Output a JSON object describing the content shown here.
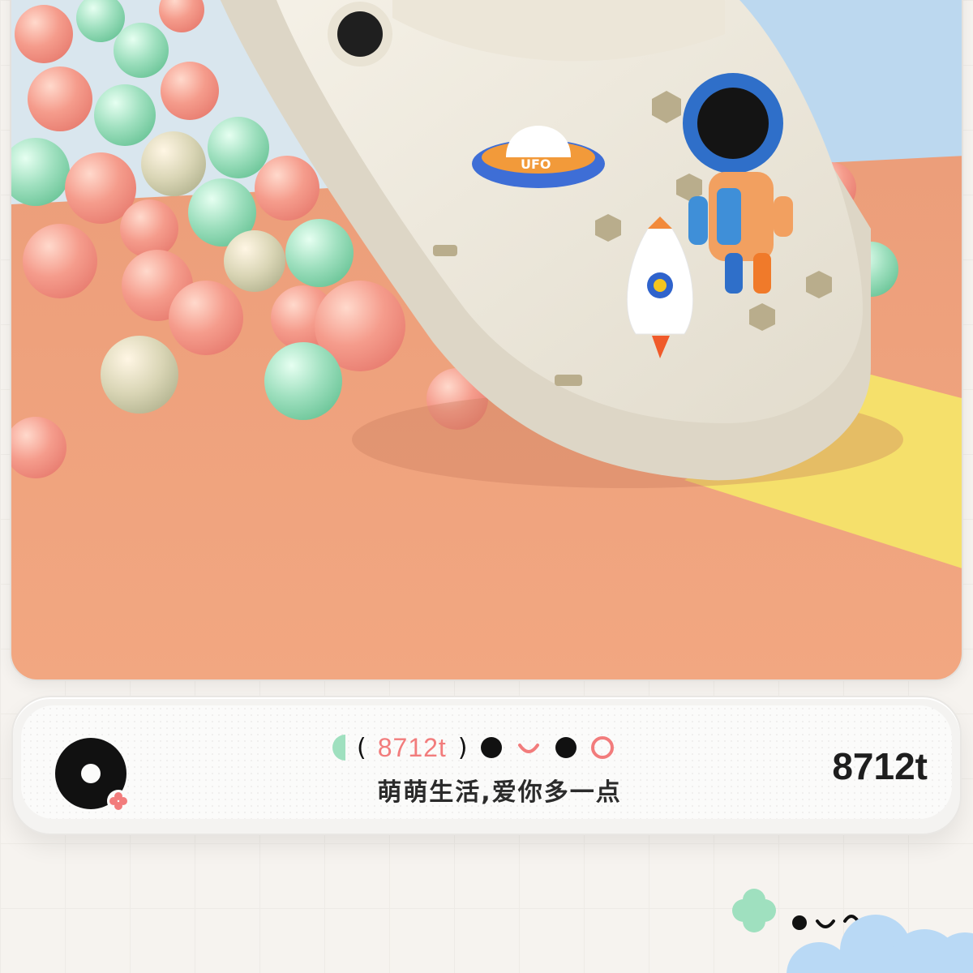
{
  "brand": {
    "code_small": "8712t",
    "code_big": "8712t",
    "slogan": "萌萌生活,爱你多一点"
  },
  "icons": [
    "brand-logo-icon",
    "clover-icon",
    "cloud-icon",
    "smiley-face-icon"
  ],
  "colors": {
    "accent_pink": "#f27c7c",
    "accent_green": "#8fdcb0",
    "floor_orange": "#f0a079",
    "stripe_yellow": "#f6e36a",
    "sky_blue": "#b8d8f1",
    "clog_white": "#efeadf"
  }
}
